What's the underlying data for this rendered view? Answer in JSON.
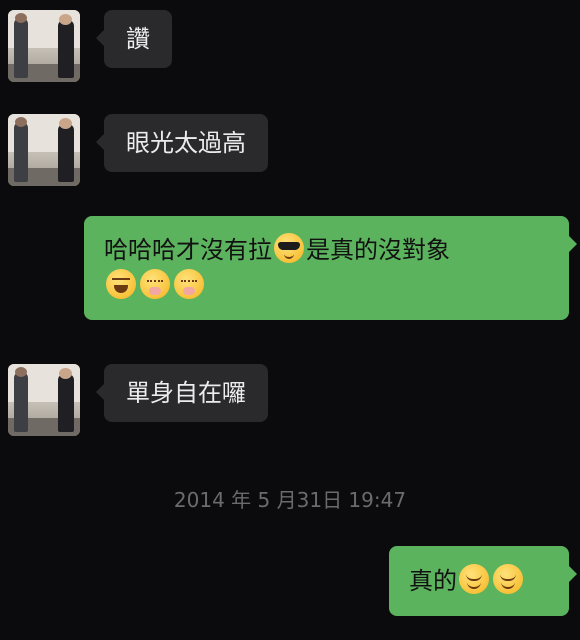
{
  "messages": [
    {
      "direction": "incoming",
      "text": "讚"
    },
    {
      "direction": "incoming",
      "text": "眼光太過高"
    },
    {
      "direction": "outgoing",
      "line1": "哈哈哈才沒有拉",
      "line1b": "是真的沒對象",
      "emojis_line1": [
        "cool-emoji"
      ],
      "emojis_line2": [
        "laugh-emoji",
        "shy-emoji",
        "shy-emoji"
      ]
    },
    {
      "direction": "incoming",
      "text": "單身自在囉"
    },
    {
      "direction": "outgoing",
      "text": "真的",
      "emojis": [
        "smile-emoji",
        "smile-emoji"
      ]
    }
  ],
  "timestamp": "2014 年 5 月31日 19:47",
  "colors": {
    "background": "#0b0b0d",
    "incoming_bubble": "#2a2a2d",
    "outgoing_bubble": "#5cb35e"
  }
}
